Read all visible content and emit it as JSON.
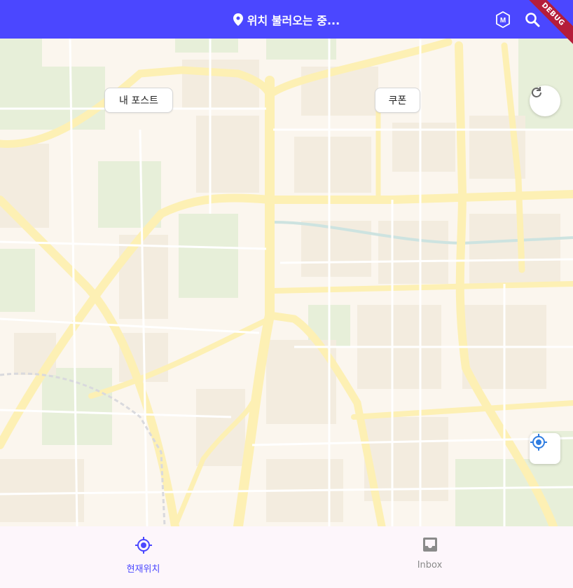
{
  "appbar": {
    "title": "위치 불러오는 중...",
    "title_icon": "location-pin-icon",
    "actions": [
      {
        "name": "m-badge-icon"
      },
      {
        "name": "search-icon"
      }
    ],
    "debug_label": "DEBUG",
    "colors": {
      "background": "#4b47ff",
      "ribbon": "#b51d3a"
    }
  },
  "map": {
    "chips": {
      "my_posts": "내 포스트",
      "coupon": "쿠폰"
    },
    "buttons": {
      "refresh": "refresh-icon",
      "my_location": "my-location-icon"
    }
  },
  "bottom_nav": {
    "items": [
      {
        "label": "현재위치",
        "icon": "my-location-icon",
        "active": true
      },
      {
        "label": "Inbox",
        "icon": "inbox-icon",
        "active": false
      }
    ],
    "colors": {
      "active": "#4b47ff",
      "inactive": "#8a8a8a"
    }
  }
}
